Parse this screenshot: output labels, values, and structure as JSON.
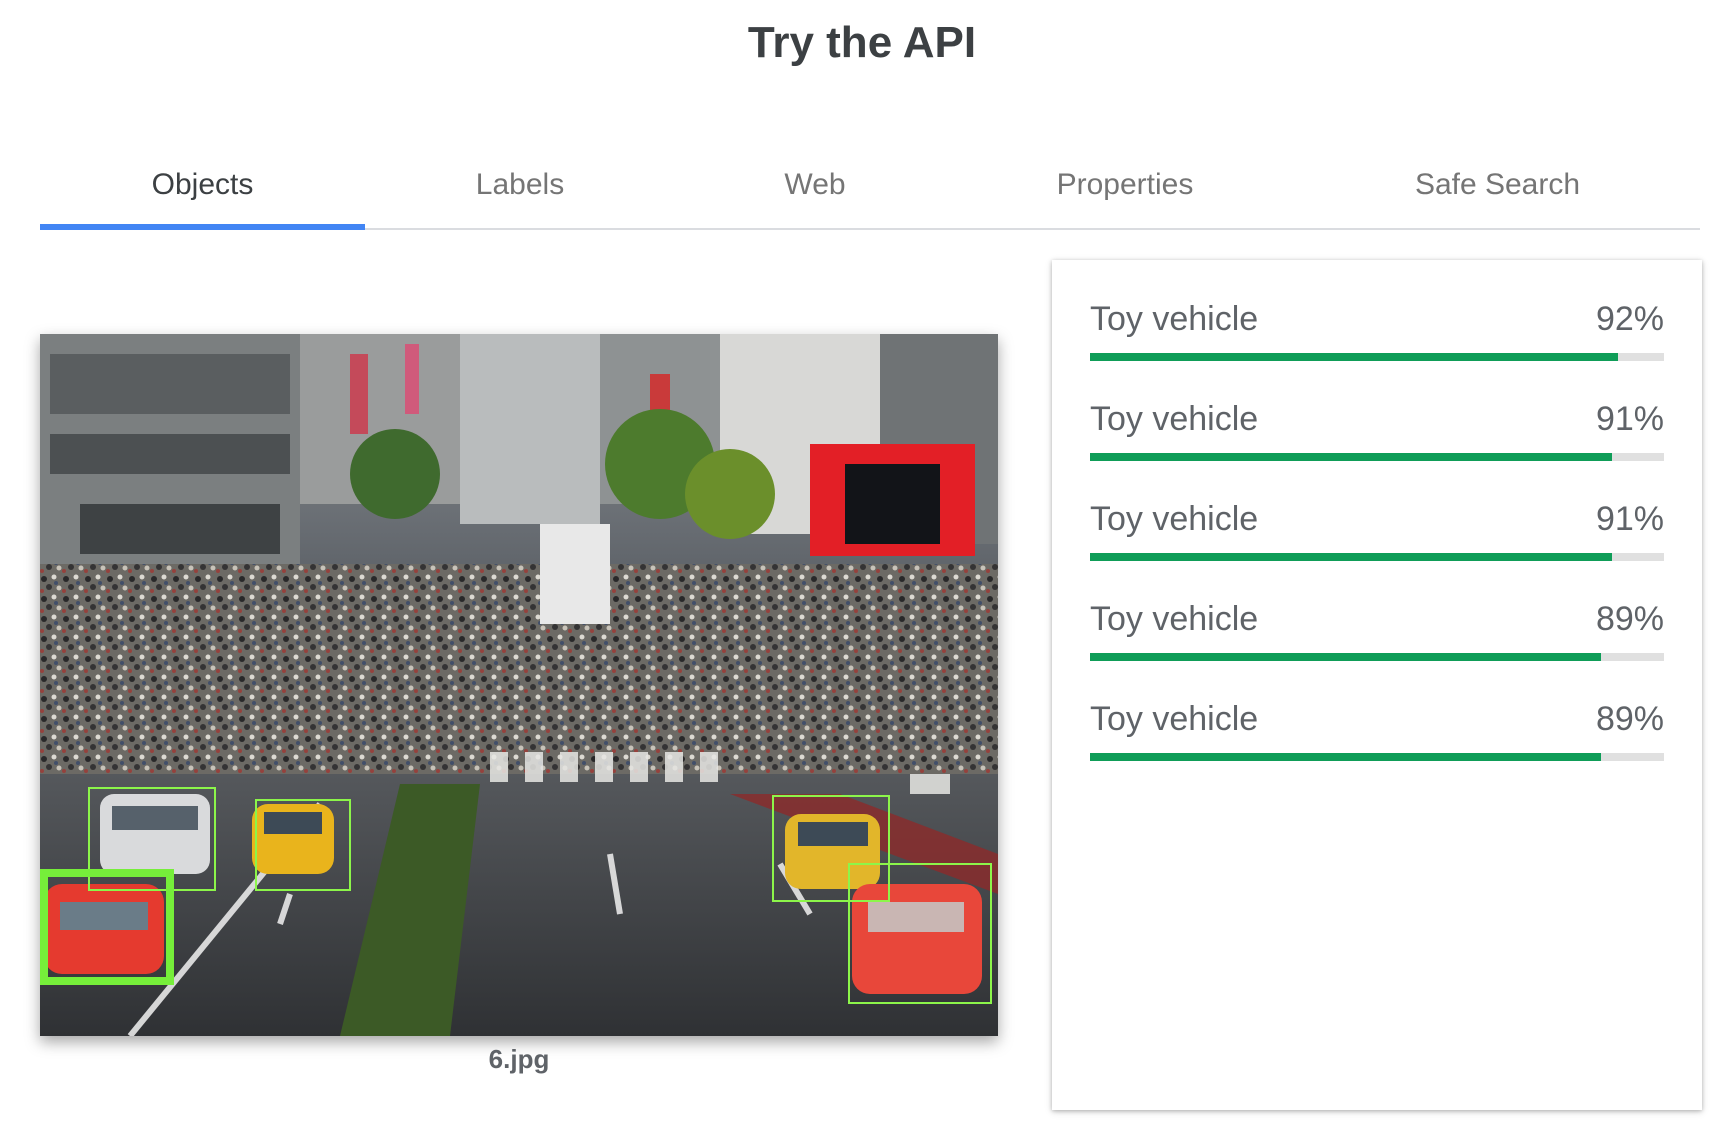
{
  "header": {
    "title": "Try the API"
  },
  "tabs": [
    {
      "label": "Objects",
      "active": true
    },
    {
      "label": "Labels",
      "active": false
    },
    {
      "label": "Web",
      "active": false
    },
    {
      "label": "Properties",
      "active": false
    },
    {
      "label": "Safe Search",
      "active": false
    }
  ],
  "image": {
    "filename": "6.jpg"
  },
  "results": [
    {
      "label": "Toy vehicle",
      "score": "92%",
      "confidence": 0.92
    },
    {
      "label": "Toy vehicle",
      "score": "91%",
      "confidence": 0.91
    },
    {
      "label": "Toy vehicle",
      "score": "91%",
      "confidence": 0.91
    },
    {
      "label": "Toy vehicle",
      "score": "89%",
      "confidence": 0.89
    },
    {
      "label": "Toy vehicle",
      "score": "89%",
      "confidence": 0.89
    }
  ],
  "colors": {
    "accent": "#4285f4",
    "bar_fill": "#0f9d58",
    "bar_track": "#e0e0e0",
    "bounding_box": "#8cf54a"
  }
}
